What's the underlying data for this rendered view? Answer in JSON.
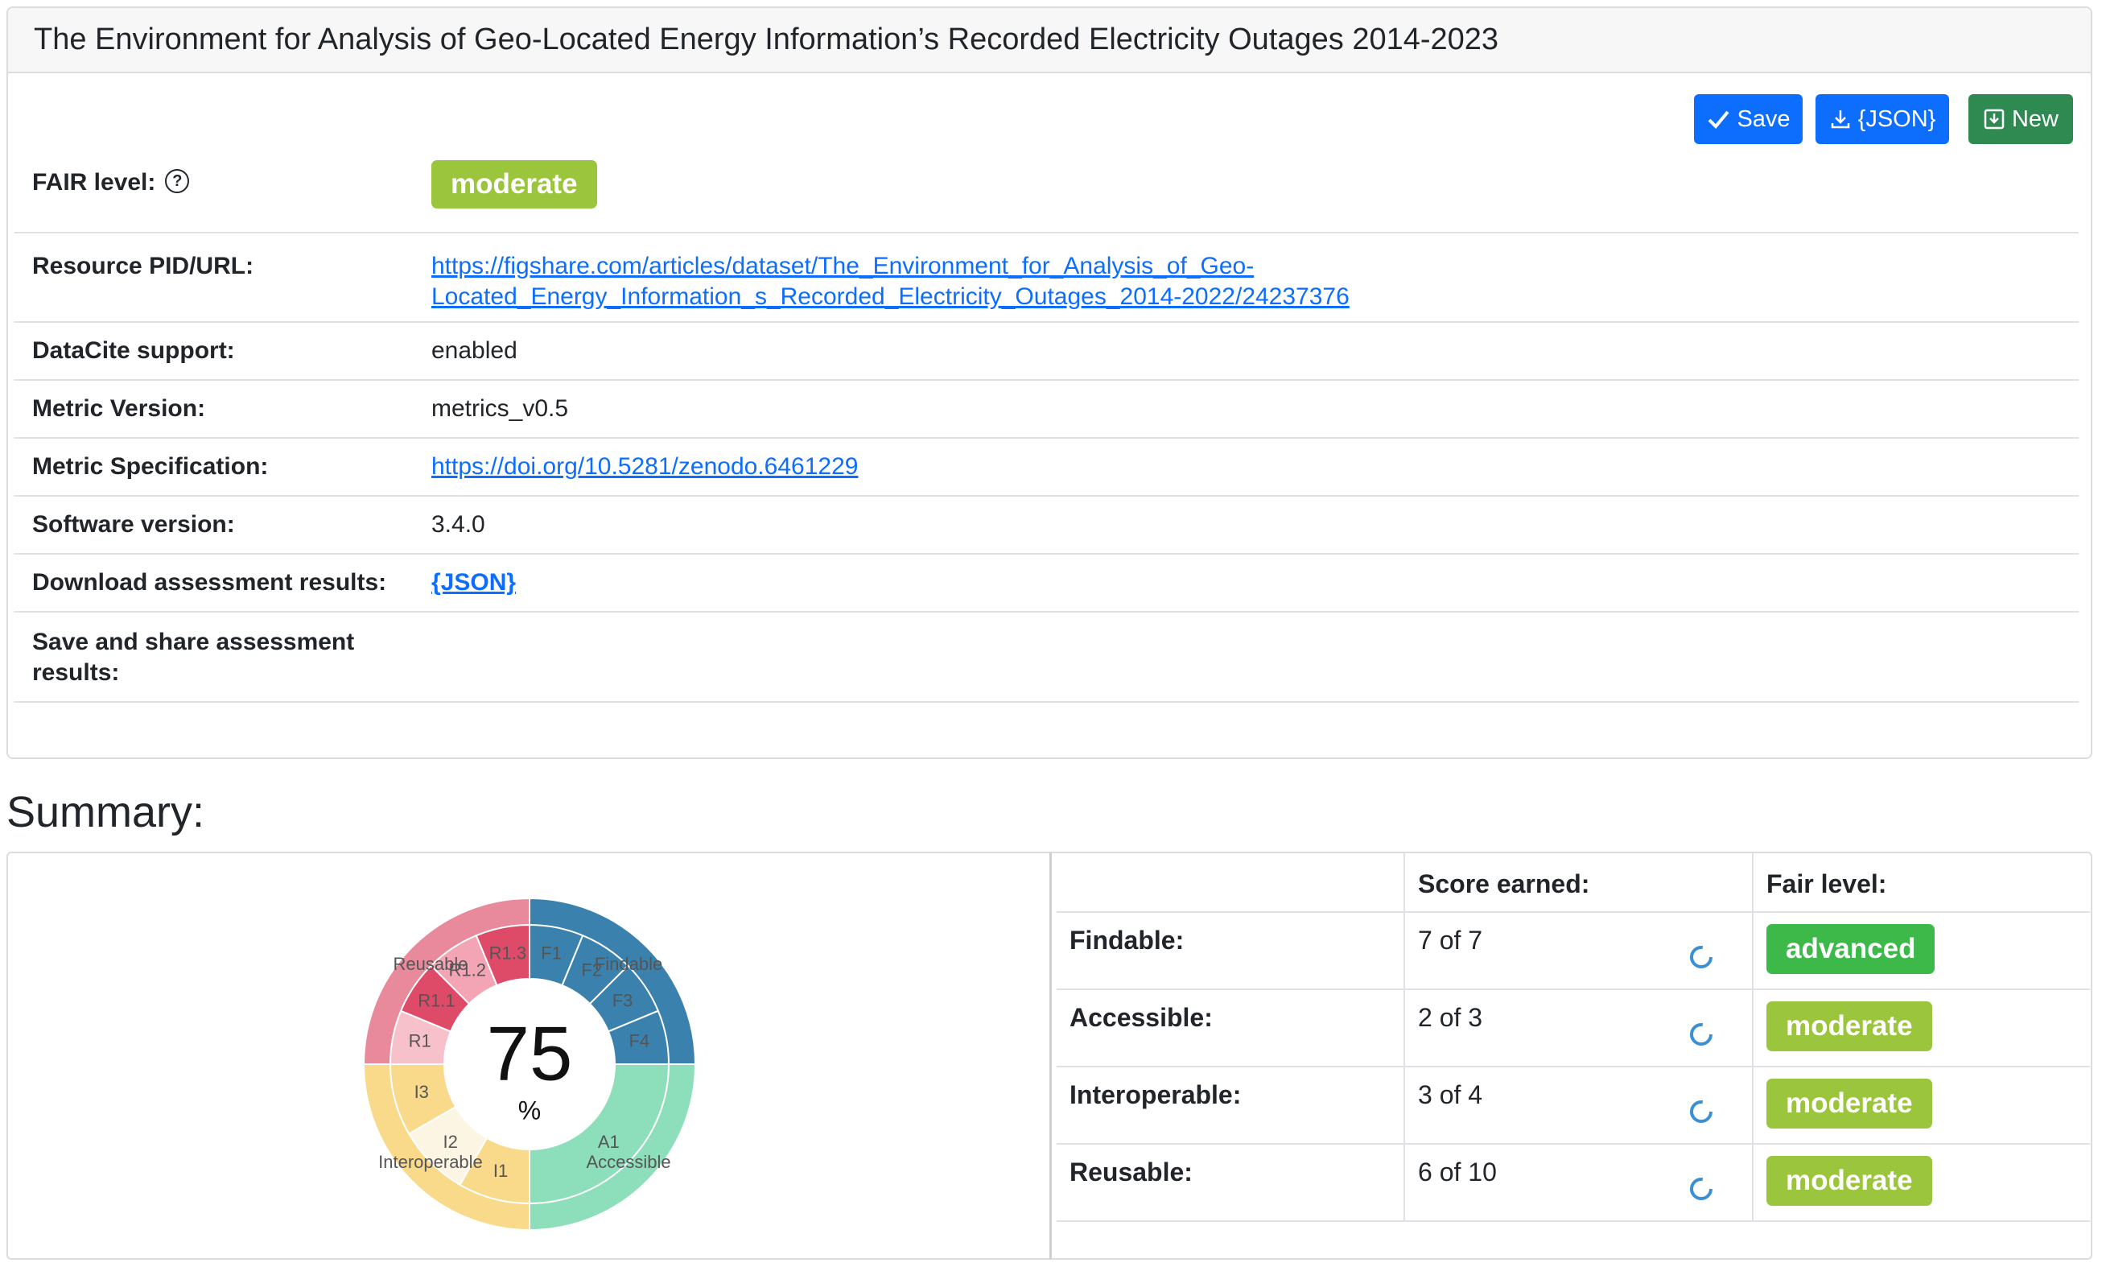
{
  "header": {
    "title": "The Environment for Analysis of Geo-Located Energy Information’s Recorded Electricity Outages 2014-2023"
  },
  "toolbar": {
    "save_label": "Save",
    "json_label": "{JSON}",
    "new_label": "New"
  },
  "info": {
    "fair_level_label": "FAIR level:",
    "fair_level_value": "moderate",
    "pid_label": "Resource PID/URL:",
    "pid_line1": "https://figshare.com/articles/dataset/The_Environment_for_Analysis_of_Geo-",
    "pid_line2": "Located_Energy_Information_s_Recorded_Electricity_Outages_2014-2022/24237376",
    "datacite_label": "DataCite support:",
    "datacite_value": "enabled",
    "metric_version_label": "Metric Version:",
    "metric_version_value": "metrics_v0.5",
    "metric_spec_label": "Metric Specification:",
    "metric_spec_value": "https://doi.org/10.5281/zenodo.6461229",
    "software_label": "Software version:",
    "software_value": "3.4.0",
    "download_label": "Download assessment results:",
    "download_value": "{JSON}",
    "save_share_label_line1": "Save and share assessment",
    "save_share_label_line2": "results:"
  },
  "summary": {
    "title": "Summary:",
    "percent_value": "75",
    "percent_sign": "%"
  },
  "chart_data": {
    "type": "sunburst",
    "center_value": 75,
    "center_unit": "%",
    "outer_ring": [
      {
        "label": "Findable",
        "color": "#3a82ad"
      },
      {
        "label": "Accessible",
        "color": "#8ddfbb"
      },
      {
        "label": "Interoperable",
        "color": "#f9d98a"
      },
      {
        "label": "Reusable",
        "color": "#e88a9c"
      }
    ],
    "inner_ring": [
      {
        "label": "F1",
        "color": "#3a82ad"
      },
      {
        "label": "F2",
        "color": "#3a82ad"
      },
      {
        "label": "F3",
        "color": "#3a82ad"
      },
      {
        "label": "F4",
        "color": "#3a82ad"
      },
      {
        "label": "A1",
        "color": "#8ddfbb"
      },
      {
        "label": "I1",
        "color": "#f9d98a"
      },
      {
        "label": "I2",
        "color": "#fdf5e4"
      },
      {
        "label": "I3",
        "color": "#f9d98a"
      },
      {
        "label": "R1",
        "color": "#f6c1cb"
      },
      {
        "label": "R1.1",
        "color": "#de4b69"
      },
      {
        "label": "R1.2",
        "color": "#f3a5b5"
      },
      {
        "label": "R1.3",
        "color": "#de4b69"
      }
    ]
  },
  "scores": {
    "header_score": "Score earned:",
    "header_level": "Fair level:",
    "rows": [
      {
        "name": "Findable:",
        "score": "7 of 7",
        "level": "advanced"
      },
      {
        "name": "Accessible:",
        "score": "2 of 3",
        "level": "moderate"
      },
      {
        "name": "Interoperable:",
        "score": "3 of 4",
        "level": "moderate"
      },
      {
        "name": "Reusable:",
        "score": "6 of 10",
        "level": "moderate"
      }
    ]
  },
  "colors": {
    "primary": "#0d6efd",
    "success": "#2f8a52",
    "moderate": "#9bc53d",
    "advanced": "#3cb949"
  }
}
